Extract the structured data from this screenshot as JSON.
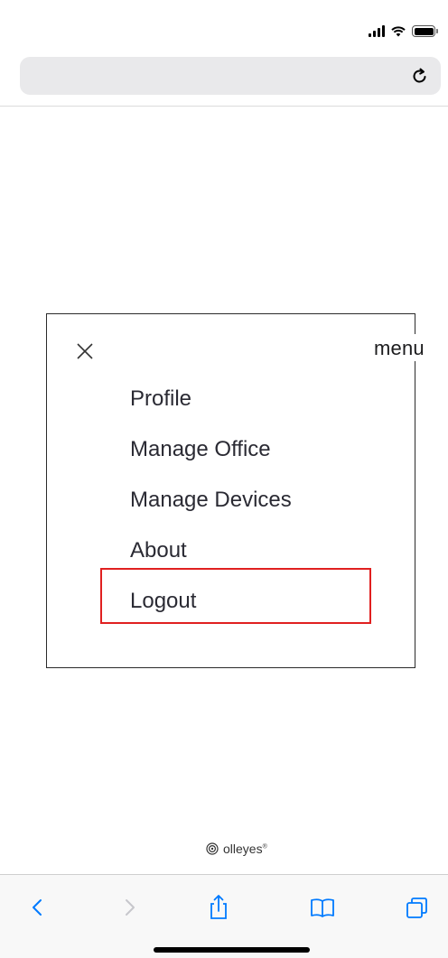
{
  "browser": {
    "address_text": ""
  },
  "menu": {
    "header_label": "menu",
    "items": [
      {
        "label": "Profile"
      },
      {
        "label": "Manage Office"
      },
      {
        "label": "Manage Devices"
      },
      {
        "label": "About"
      },
      {
        "label": "Logout"
      }
    ],
    "highlighted_item": "Logout",
    "highlight_color": "#e02020"
  },
  "footer": {
    "brand_name": "olleyes",
    "brand_mark": "®"
  },
  "icons": {
    "status": [
      "signal-icon",
      "wifi-icon",
      "battery-icon"
    ],
    "toolbar": [
      "back-icon",
      "forward-icon",
      "share-icon",
      "bookmarks-icon",
      "tabs-icon"
    ]
  },
  "colors": {
    "accent_blue": "#007aff",
    "disabled_gray": "#c7c7cc",
    "panel_border": "#2b2b2b"
  }
}
